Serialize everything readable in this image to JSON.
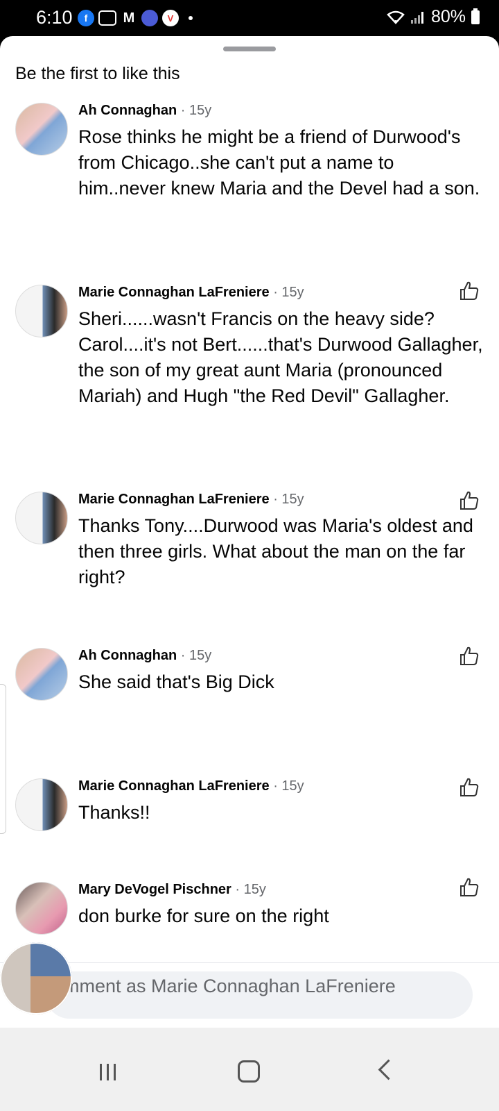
{
  "status": {
    "time": "6:10",
    "battery": "80%",
    "notification_icons": [
      "facebook-icon",
      "camera-icon",
      "gmail-icon",
      "messages-icon",
      "vivaldi-icon"
    ]
  },
  "sheet": {
    "reactions_text": "Be the first to like this"
  },
  "comments": [
    {
      "author": "Ah Connaghan",
      "age": "· 15y",
      "text": "Rose thinks he might be a friend of Durwood's from Chicago..she can't put a name to him..never knew Maria and the Devel had a son."
    },
    {
      "author": "Marie Connaghan LaFreniere",
      "age": "· 15y",
      "text": "Sheri......wasn't Francis on the heavy side? Carol....it's not Bert......that's Durwood Gallagher, the son of my great aunt Maria (pronounced Mariah) and Hugh \"the Red Devil\" Gallagher."
    },
    {
      "author": "Marie Connaghan LaFreniere",
      "age": "· 15y",
      "text": "Thanks Tony....Durwood was Maria's oldest and then three girls. What about the man on the far right?"
    },
    {
      "author": "Ah Connaghan",
      "age": "· 15y",
      "text": "She said that's Big Dick"
    },
    {
      "author": "Marie Connaghan LaFreniere",
      "age": "· 15y",
      "text": "Thanks!!"
    },
    {
      "author": "Mary DeVogel Pischner",
      "age": "· 15y",
      "text": "don burke for sure on the right"
    }
  ],
  "composer": {
    "placeholder": "mment as Marie Connaghan LaFreniere"
  },
  "colors": {
    "text": "#050505",
    "secondary": "#65676b",
    "facebook_blue": "#1877f2"
  }
}
